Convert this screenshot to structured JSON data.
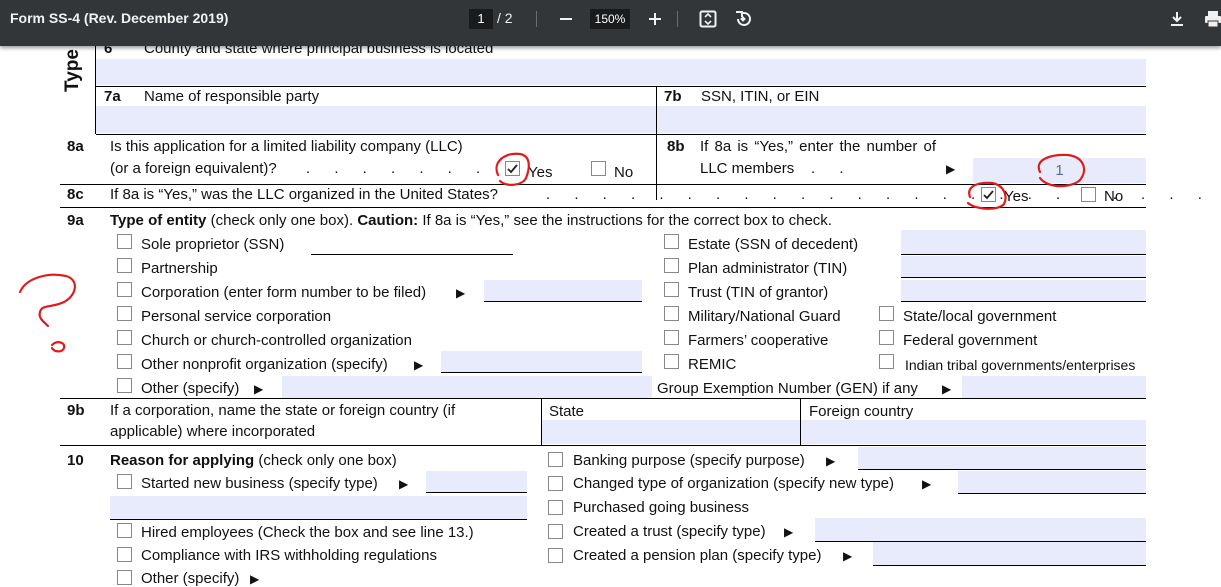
{
  "toolbar": {
    "title": "Form SS-4 (Rev. December 2019)",
    "page_current": "1",
    "page_sep": "/",
    "page_total": "2",
    "zoom": "150%",
    "icons": [
      "minus-icon",
      "plus-icon",
      "fit-page-icon",
      "rotate-icon",
      "download-icon",
      "print-icon",
      "more-icon"
    ]
  },
  "form": {
    "type_label": "Type",
    "line6": {
      "num": "6",
      "label": "County and state where principal business is located"
    },
    "line7a": {
      "num": "7a",
      "label": "Name of responsible party"
    },
    "line7b": {
      "num": "7b",
      "label": "SSN, ITIN, or EIN"
    },
    "line8a": {
      "num": "8a",
      "label1": "Is this application for a limited liability company (LLC)",
      "label2": "(or a foreign equivalent)?",
      "dots": ". . . . . . . .",
      "yes": "Yes",
      "no": "No",
      "yes_checked": true
    },
    "line8b": {
      "num": "8b",
      "label1": "If 8a is “Yes,” enter the number of",
      "label2": "LLC members",
      "dots": ". .",
      "value": "1"
    },
    "line8c": {
      "num": "8c",
      "label": "If 8a is “Yes,” was the LLC organized in the United States?",
      "dots": ". . . . . . . . . . . . . . . . . . . . . . . . .",
      "yes": "Yes",
      "no": "No",
      "yes_checked": true
    },
    "line9a": {
      "num": "9a",
      "title_bold": "Type of entity",
      "title_rest": " (check only one box). ",
      "caution_bold": "Caution:",
      "caution_rest": " If 8a is “Yes,” see the instructions for the correct box to check.",
      "left": [
        "Sole proprietor (SSN)",
        "Partnership",
        "Corporation (enter form number to be filed)",
        "Personal service corporation",
        "Church or church-controlled organization",
        "Other nonprofit organization (specify)",
        "Other (specify)"
      ],
      "middle": [
        "Estate (SSN of decedent)",
        "Plan administrator (TIN)",
        "Trust (TIN of grantor)",
        "Military/National Guard",
        "Farmers’ cooperative",
        "REMIC"
      ],
      "right": [
        "State/local government",
        "Federal government",
        "Indian tribal governments/enterprises"
      ],
      "gen": "Group Exemption Number (GEN) if any"
    },
    "line9b": {
      "num": "9b",
      "label1": "If a corporation, name the state or foreign country (if",
      "label2": "applicable) where incorporated",
      "state": "State",
      "foreign": "Foreign country"
    },
    "line10": {
      "num": "10",
      "title_bold": "Reason for applying",
      "title_rest": " (check only one box)",
      "left": [
        "Started new business (specify type)",
        "Hired employees (Check the box and see line 13.)",
        "Compliance with IRS withholding regulations",
        "Other (specify)"
      ],
      "right": [
        "Banking purpose (specify purpose)",
        "Changed type of organization (specify new type)",
        "Purchased going business",
        "Created a trust (specify type)",
        "Created a pension plan (specify type)"
      ]
    }
  },
  "annotation": {
    "mark": "?",
    "color": "#e01b1b"
  },
  "colors": {
    "toolbar": "#323639",
    "field": "#e8ebfb",
    "annotation": "#e01b1b"
  }
}
